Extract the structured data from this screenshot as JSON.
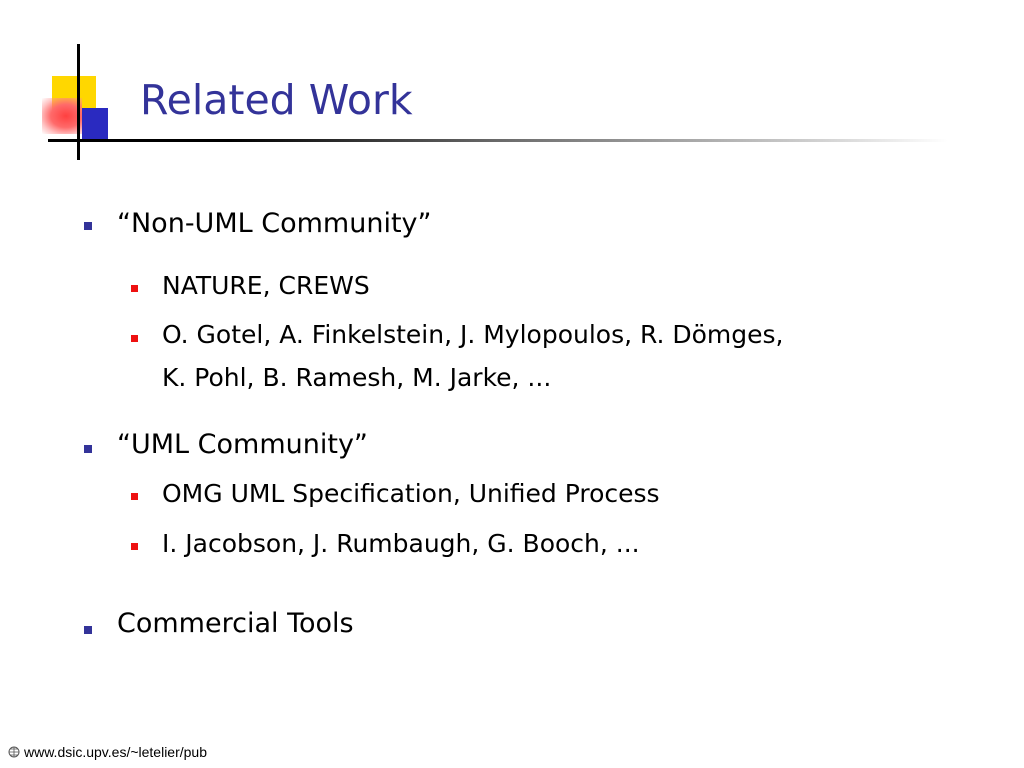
{
  "slide": {
    "title": "Related Work",
    "sections": [
      {
        "heading": "“Non-UML Community”",
        "items": [
          "NATURE, CREWS",
          "O. Gotel, A. Finkelstein, J. Mylopoulos, R. Dömges,",
          "K. Pohl, B. Ramesh, M. Jarke, ..."
        ]
      },
      {
        "heading": "“UML Community”",
        "items": [
          "OMG UML Specification, Unified Process",
          "I. Jacobson, J. Rumbaugh, G. Booch, ..."
        ]
      },
      {
        "heading": "Commercial Tools",
        "items": []
      }
    ]
  },
  "footer": {
    "url": "www.dsic.upv.es/~letelier/pub",
    "icon": "web-globe-icon"
  },
  "colors": {
    "title": "#333399",
    "level1_bullet": "#333399",
    "level2_bullet": "#ee1111",
    "accent_yellow": "#ffd700",
    "accent_blue": "#2a2ac0"
  }
}
